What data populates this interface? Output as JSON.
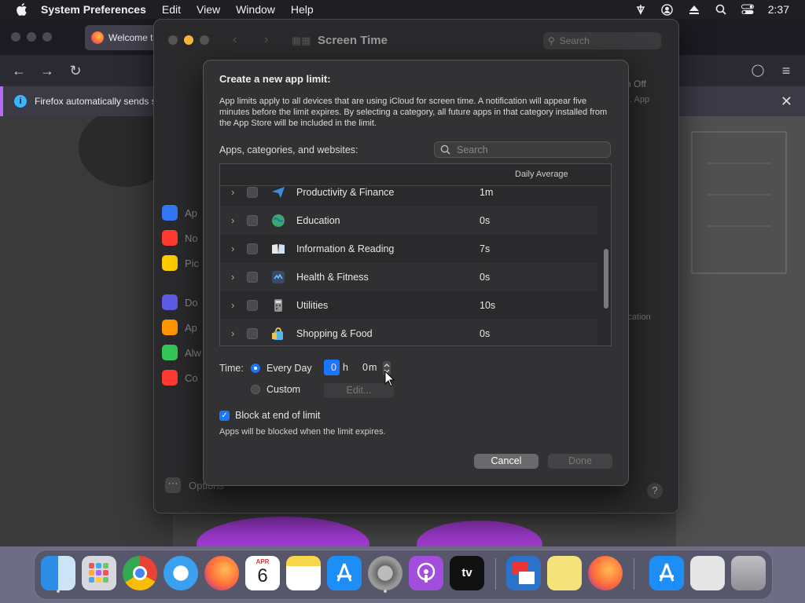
{
  "menubar": {
    "app_name": "System Preferences",
    "items": [
      "Edit",
      "View",
      "Window",
      "Help"
    ],
    "clock": "2:37",
    "status_icons": [
      "wifi-icon",
      "user-icon",
      "eject-icon",
      "search-icon",
      "control-center-icon"
    ]
  },
  "firefox": {
    "tab_title": "Welcome t",
    "notice_text": "Firefox automatically sends s",
    "nav_icons": [
      "back-icon",
      "forward-icon",
      "reload-icon"
    ]
  },
  "prefs": {
    "title": "Screen Time",
    "search_placeholder": "Search",
    "sidebar": [
      {
        "label": "Ap",
        "color": "#3478f6"
      },
      {
        "label": "No",
        "color": "#ff3b30"
      },
      {
        "label": "Pic",
        "color": "#ffcc00"
      },
      {
        "label": "Do",
        "color": "#5e5ce6"
      },
      {
        "label": "Ap",
        "color": "#ff9500"
      },
      {
        "label": "Alw",
        "color": "#34c759"
      },
      {
        "label": "Co",
        "color": "#ff3b30"
      }
    ],
    "options_label": "Options",
    "bg_text_off": "n Off",
    "bg_text_app": ". App",
    "bg_text_cation": "ication"
  },
  "sheet": {
    "heading": "Create a new app limit:",
    "description": "App limits apply to all devices that are using iCloud for screen time. A notification will appear five minutes before the limit expires. By selecting a category, all future apps in that category installed from the App Store will be included in the limit.",
    "apps_label": "Apps, categories, and websites:",
    "search_placeholder": "Search",
    "column_daily_average": "Daily Average",
    "rows": [
      {
        "name": "Productivity & Finance",
        "avg": "1m",
        "icon": "paper-plane-icon",
        "color": "#3a8bdc"
      },
      {
        "name": "Education",
        "avg": "0s",
        "icon": "globe-icon",
        "color": "#3aa76d"
      },
      {
        "name": "Information & Reading",
        "avg": "7s",
        "icon": "book-icon",
        "color": "#6aa4d8"
      },
      {
        "name": "Health & Fitness",
        "avg": "0s",
        "icon": "fitness-icon",
        "color": "#3a4a66"
      },
      {
        "name": "Utilities",
        "avg": "10s",
        "icon": "calculator-icon",
        "color": "#8e8e93"
      },
      {
        "name": "Shopping & Food",
        "avg": "0s",
        "icon": "shopping-bag-icon",
        "color": "#53b7e8"
      }
    ],
    "time_label": "Time:",
    "every_day_label": "Every Day",
    "hours_value": "0",
    "hours_unit": "h",
    "minutes_value": "0",
    "minutes_unit": "m",
    "custom_label": "Custom",
    "edit_label": "Edit...",
    "block_label": "Block at end of limit",
    "block_sub": "Apps will be blocked when the limit expires.",
    "cancel_label": "Cancel",
    "done_label": "Done"
  },
  "dock": {
    "apps": [
      "Finder",
      "Launchpad",
      "Chrome",
      "Safari",
      "Firefox",
      "Calendar",
      "Notes",
      "App Store",
      "System Preferences",
      "Podcasts",
      "TV",
      "Screen Share",
      "Stickies",
      "Firefox",
      "App Store",
      "Preview",
      "Trash"
    ],
    "calendar_month": "APR",
    "calendar_day": "6",
    "tv_label": "tv"
  }
}
